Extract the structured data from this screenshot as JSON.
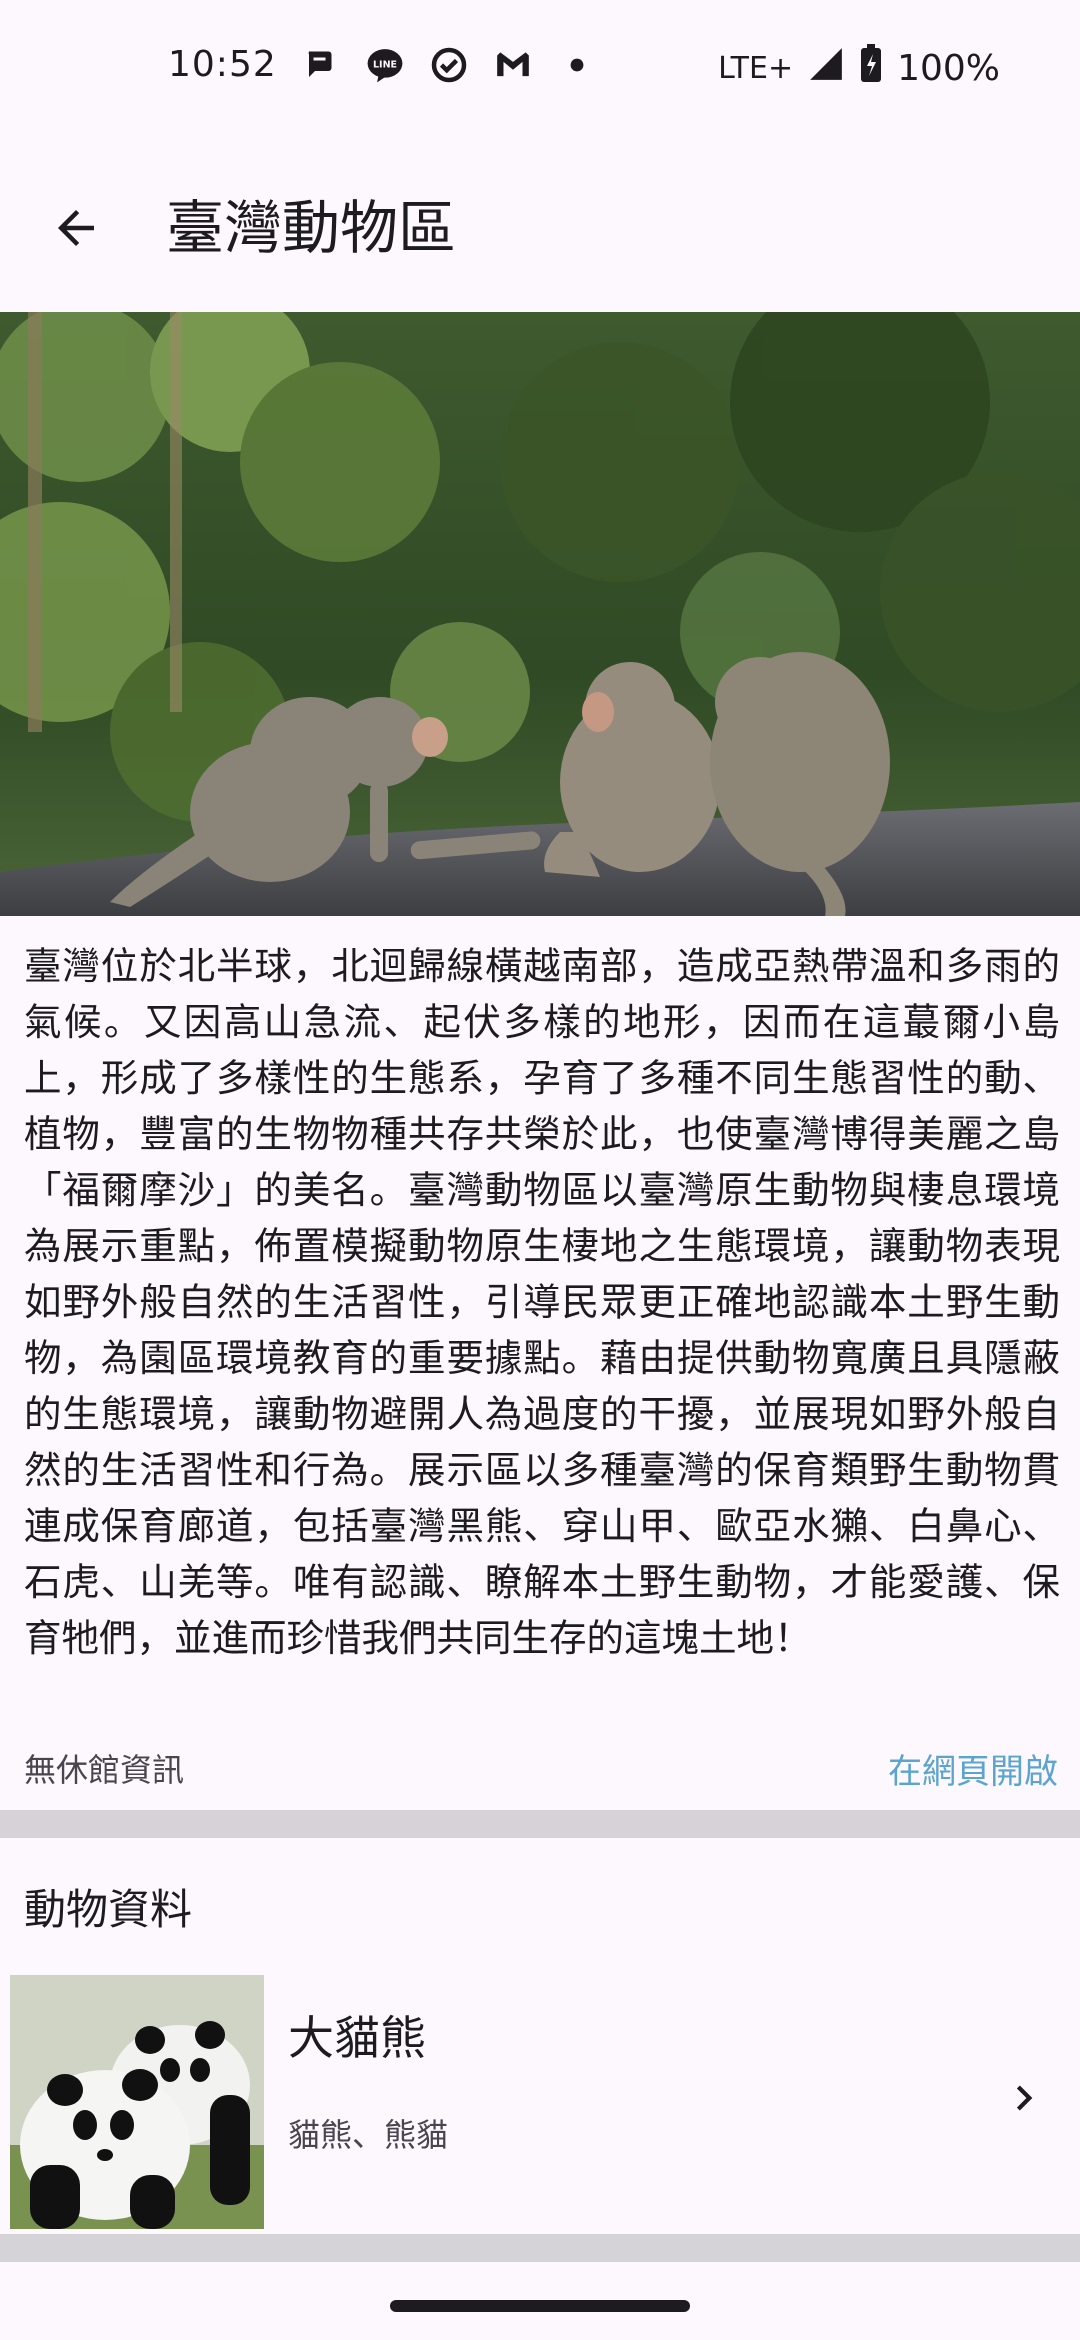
{
  "status_bar": {
    "time": "10:52",
    "network": "LTE+",
    "battery": "100%",
    "notification_icons": [
      "chat-icon",
      "line-icon",
      "check-circle-icon",
      "gmail-icon",
      "dot-icon"
    ]
  },
  "header": {
    "title": "臺灣動物區"
  },
  "hero_image": {
    "subject": "monkeys-on-log"
  },
  "description": "臺灣位於北半球，北迴歸線橫越南部，造成亞熱帶溫和多雨的氣候。又因高山急流、起伏多樣的地形，因而在這蕞爾小島上，形成了多樣性的生態系，孕育了多種不同生態習性的動、植物，豐富的生物物種共存共榮於此，也使臺灣博得美麗之島「福爾摩沙」的美名。臺灣動物區以臺灣原生動物與棲息環境為展示重點，佈置模擬動物原生棲地之生態環境，讓動物表現如野外般自然的生活習性，引導民眾更正確地認識本土野生動物，為園區環境教育的重要據點。藉由提供動物寬廣且具隱蔽的生態環境，讓動物避開人為過度的干擾，並展現如野外般自然的生活習性和行為。展示區以多種臺灣的保育類野生動物貫連成保育廊道，包括臺灣黑熊、穿山甲、歐亞水獺、白鼻心、石虎、山羌等。唯有認識、瞭解本土野生動物，才能愛護、保育牠們，並進而珍惜我們共同生存的這塊土地！",
  "info": {
    "closing": "無休館資訊",
    "open_web": "在網頁開啟"
  },
  "animals_section": {
    "title": "動物資料",
    "items": [
      {
        "name": "大貓熊",
        "alias": "貓熊、熊貓"
      }
    ]
  },
  "colors": {
    "background": "#fdf8fd",
    "link": "#5ba4cf",
    "divider": "#d5d3d7"
  }
}
